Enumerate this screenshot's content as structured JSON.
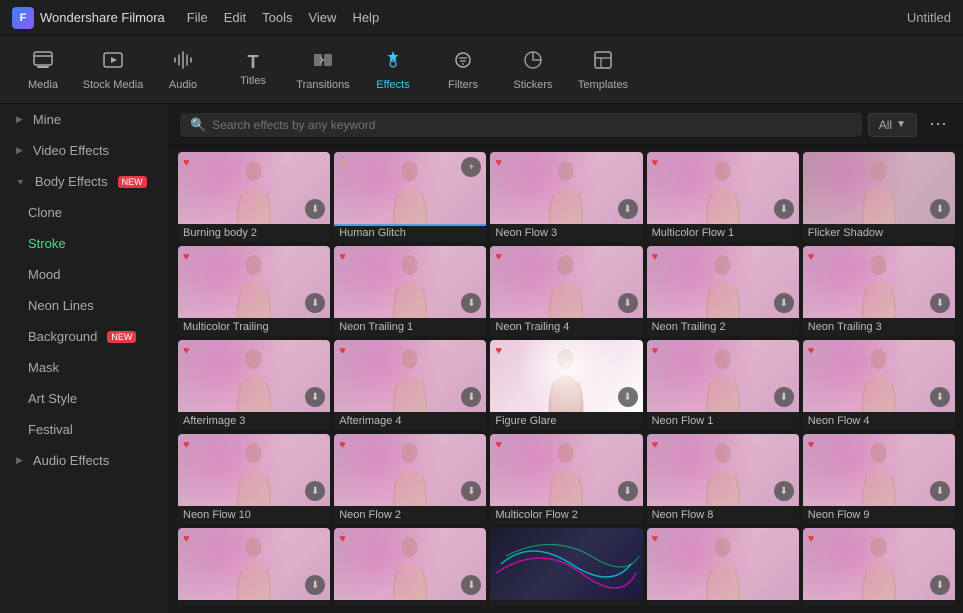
{
  "titleBar": {
    "appName": "Wondershare Filmora",
    "menuItems": [
      "File",
      "Edit",
      "Tools",
      "View",
      "Help"
    ],
    "windowTitle": "Untitled"
  },
  "toolbar": {
    "items": [
      {
        "id": "media",
        "label": "Media",
        "icon": "📽"
      },
      {
        "id": "stock-media",
        "label": "Stock Media",
        "icon": "🎬"
      },
      {
        "id": "audio",
        "label": "Audio",
        "icon": "🎵"
      },
      {
        "id": "titles",
        "label": "Titles",
        "icon": "T"
      },
      {
        "id": "transitions",
        "label": "Transitions",
        "icon": "⟷"
      },
      {
        "id": "effects",
        "label": "Effects",
        "icon": "✦"
      },
      {
        "id": "filters",
        "label": "Filters",
        "icon": "🔆"
      },
      {
        "id": "stickers",
        "label": "Stickers",
        "icon": "⬡"
      },
      {
        "id": "templates",
        "label": "Templates",
        "icon": "⬜"
      }
    ],
    "activeItem": "effects"
  },
  "sidebar": {
    "items": [
      {
        "id": "mine",
        "label": "Mine",
        "indent": false,
        "expandable": true,
        "active": false,
        "isNew": false
      },
      {
        "id": "video-effects",
        "label": "Video Effects",
        "indent": false,
        "expandable": true,
        "active": false,
        "isNew": false
      },
      {
        "id": "body-effects",
        "label": "Body Effects",
        "indent": false,
        "expandable": true,
        "active": false,
        "isNew": true,
        "expanded": true
      },
      {
        "id": "clone",
        "label": "Clone",
        "indent": true,
        "expandable": false,
        "active": false,
        "isNew": false
      },
      {
        "id": "stroke",
        "label": "Stroke",
        "indent": true,
        "expandable": false,
        "active": true,
        "isNew": false
      },
      {
        "id": "mood",
        "label": "Mood",
        "indent": true,
        "expandable": false,
        "active": false,
        "isNew": false
      },
      {
        "id": "neon-lines",
        "label": "Neon Lines",
        "indent": true,
        "expandable": false,
        "active": false,
        "isNew": false
      },
      {
        "id": "background",
        "label": "Background",
        "indent": true,
        "expandable": false,
        "active": false,
        "isNew": true
      },
      {
        "id": "mask",
        "label": "Mask",
        "indent": true,
        "expandable": false,
        "active": false,
        "isNew": false
      },
      {
        "id": "art-style",
        "label": "Art Style",
        "indent": true,
        "expandable": false,
        "active": false,
        "isNew": false
      },
      {
        "id": "festival",
        "label": "Festival",
        "indent": true,
        "expandable": false,
        "active": false,
        "isNew": false
      },
      {
        "id": "audio-effects",
        "label": "Audio Effects",
        "indent": false,
        "expandable": true,
        "active": false,
        "isNew": false
      }
    ]
  },
  "search": {
    "placeholder": "Search effects by any keyword",
    "filterLabel": "All",
    "value": ""
  },
  "effects": {
    "items": [
      {
        "id": 1,
        "name": "Burning body 2",
        "hasFav": true,
        "hasDownload": true,
        "hasOverlay": false,
        "highlighted": false,
        "thumbStyle": "pink"
      },
      {
        "id": 2,
        "name": "Human Glitch",
        "hasFav": false,
        "hasDownload": false,
        "hasOverlay": true,
        "hasStar": true,
        "highlighted": true,
        "thumbStyle": "pink"
      },
      {
        "id": 3,
        "name": "Neon Flow 3",
        "hasFav": true,
        "hasDownload": true,
        "hasOverlay": false,
        "highlighted": false,
        "thumbStyle": "pink"
      },
      {
        "id": 4,
        "name": "Multicolor Flow 1",
        "hasFav": true,
        "hasDownload": true,
        "hasOverlay": false,
        "highlighted": false,
        "thumbStyle": "pink"
      },
      {
        "id": 5,
        "name": "Flicker Shadow",
        "hasFav": false,
        "hasDownload": true,
        "hasOverlay": false,
        "highlighted": false,
        "thumbStyle": "dark-pink"
      },
      {
        "id": 6,
        "name": "Multicolor Trailing",
        "hasFav": true,
        "hasDownload": true,
        "hasOverlay": false,
        "highlighted": false,
        "thumbStyle": "pink"
      },
      {
        "id": 7,
        "name": "Neon Trailing 1",
        "hasFav": true,
        "hasDownload": true,
        "hasOverlay": false,
        "highlighted": false,
        "thumbStyle": "pink"
      },
      {
        "id": 8,
        "name": "Neon Trailing 4",
        "hasFav": true,
        "hasDownload": true,
        "hasOverlay": false,
        "highlighted": false,
        "thumbStyle": "pink"
      },
      {
        "id": 9,
        "name": "Neon Trailing 2",
        "hasFav": true,
        "hasDownload": true,
        "hasOverlay": false,
        "highlighted": false,
        "thumbStyle": "pink"
      },
      {
        "id": 10,
        "name": "Neon Trailing 3",
        "hasFav": true,
        "hasDownload": true,
        "hasOverlay": false,
        "highlighted": false,
        "thumbStyle": "pink"
      },
      {
        "id": 11,
        "name": "Afterimage 3",
        "hasFav": true,
        "hasDownload": true,
        "hasOverlay": false,
        "highlighted": false,
        "thumbStyle": "pink"
      },
      {
        "id": 12,
        "name": "Afterimage 4",
        "hasFav": true,
        "hasDownload": true,
        "hasOverlay": false,
        "highlighted": false,
        "thumbStyle": "pink"
      },
      {
        "id": 13,
        "name": "Figure Glare",
        "hasFav": true,
        "hasDownload": true,
        "hasOverlay": false,
        "highlighted": false,
        "thumbStyle": "bright"
      },
      {
        "id": 14,
        "name": "Neon Flow 1",
        "hasFav": true,
        "hasDownload": true,
        "hasOverlay": false,
        "highlighted": false,
        "thumbStyle": "pink"
      },
      {
        "id": 15,
        "name": "Neon Flow 4",
        "hasFav": true,
        "hasDownload": true,
        "hasOverlay": false,
        "highlighted": false,
        "thumbStyle": "pink"
      },
      {
        "id": 16,
        "name": "Neon Flow 10",
        "hasFav": true,
        "hasDownload": true,
        "hasOverlay": false,
        "highlighted": false,
        "thumbStyle": "pink"
      },
      {
        "id": 17,
        "name": "Neon Flow 2",
        "hasFav": true,
        "hasDownload": true,
        "hasOverlay": false,
        "highlighted": false,
        "thumbStyle": "pink"
      },
      {
        "id": 18,
        "name": "Multicolor Flow 2",
        "hasFav": true,
        "hasDownload": true,
        "hasOverlay": false,
        "highlighted": false,
        "thumbStyle": "pink"
      },
      {
        "id": 19,
        "name": "Neon Flow 8",
        "hasFav": true,
        "hasDownload": true,
        "hasOverlay": false,
        "highlighted": false,
        "thumbStyle": "pink"
      },
      {
        "id": 20,
        "name": "Neon Flow 9",
        "hasFav": true,
        "hasDownload": true,
        "hasOverlay": false,
        "highlighted": false,
        "thumbStyle": "pink"
      },
      {
        "id": 21,
        "name": "",
        "hasFav": true,
        "hasDownload": true,
        "hasOverlay": false,
        "highlighted": false,
        "thumbStyle": "pink"
      },
      {
        "id": 22,
        "name": "",
        "hasFav": true,
        "hasDownload": true,
        "hasOverlay": false,
        "highlighted": false,
        "thumbStyle": "pink"
      },
      {
        "id": 23,
        "name": "",
        "hasFav": false,
        "hasDownload": false,
        "hasOverlay": false,
        "highlighted": false,
        "thumbStyle": "neon-lines"
      },
      {
        "id": 24,
        "name": "",
        "hasFav": true,
        "hasDownload": false,
        "hasOverlay": false,
        "highlighted": false,
        "thumbStyle": "pink"
      },
      {
        "id": 25,
        "name": "",
        "hasFav": true,
        "hasDownload": true,
        "hasOverlay": false,
        "highlighted": false,
        "thumbStyle": "pink"
      }
    ]
  }
}
